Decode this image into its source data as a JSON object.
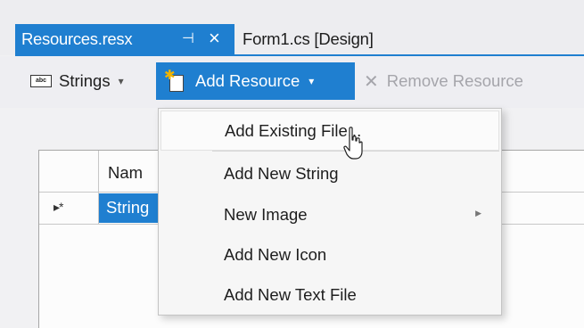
{
  "tabs": {
    "active": {
      "label": "Resources.resx",
      "pin_icon": "pin-icon",
      "close_icon": "close-icon"
    },
    "inactive": {
      "label": "Form1.cs [Design]"
    }
  },
  "toolbar": {
    "strings_label": "Strings",
    "strings_icon": "abc-icon",
    "add_resource_label": "Add Resource",
    "remove_resource_label": "Remove Resource"
  },
  "grid": {
    "header_name": "Nam",
    "row_marker": "▸*",
    "row_cell": "String"
  },
  "menu": {
    "items": [
      {
        "label": "Add Existing File..."
      },
      {
        "label": "Add New String"
      },
      {
        "label": "New Image"
      },
      {
        "label": "Add New Icon"
      },
      {
        "label": "Add New Text File"
      }
    ]
  },
  "colors": {
    "accent": "#1f7fd0",
    "disabled": "#a5a5ab"
  }
}
